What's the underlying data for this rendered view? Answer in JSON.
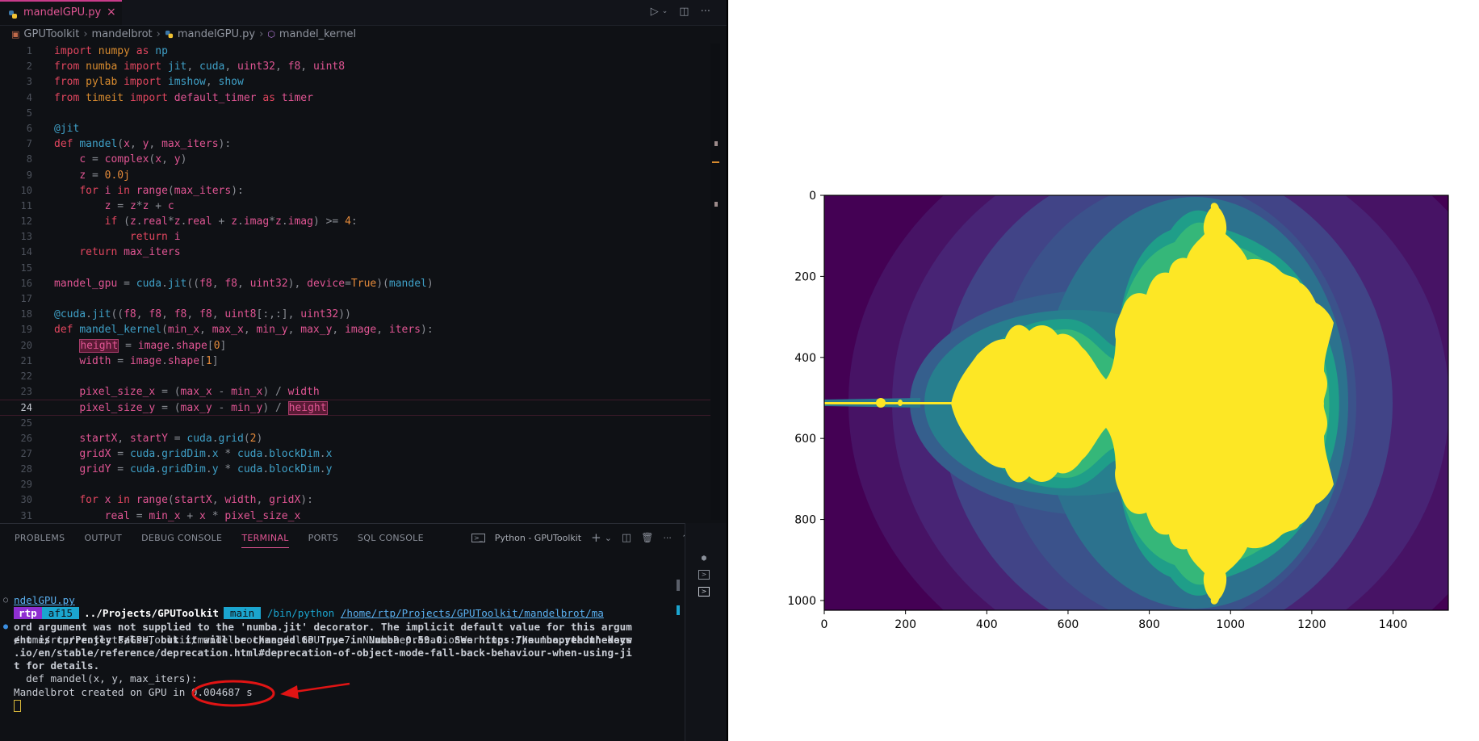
{
  "editor": {
    "tab_label": "mandelGPU.py",
    "tab_close": "×",
    "breadcrumb": [
      "GPUToolkit",
      "mandelbrot",
      "mandelGPU.py",
      "mandel_kernel"
    ],
    "active_line": 24
  },
  "code_lines": [
    "1",
    "2",
    "3",
    "4",
    "5",
    "6",
    "7",
    "8",
    "9",
    "10",
    "11",
    "12",
    "13",
    "14",
    "15",
    "16",
    "17",
    "18",
    "19",
    "20",
    "21",
    "22",
    "23",
    "24",
    "25",
    "26",
    "27",
    "28",
    "29",
    "30",
    "31"
  ],
  "panel": {
    "tabs": [
      "PROBLEMS",
      "OUTPUT",
      "DEBUG CONSOLE",
      "TERMINAL",
      "PORTS",
      "SQL CONSOLE"
    ],
    "active_tab": "TERMINAL",
    "terminal_name": "Python - GPUToolkit"
  },
  "terminal": {
    "prompt_user": "rtp",
    "prompt_hash": "af15",
    "prompt_path": "../Projects/GPUToolkit",
    "prompt_branch": "main",
    "command_prefix": " /bin/python ",
    "command_link_1": "/home/rtp/Projects/GPUToolkit/mandelbrot/ma",
    "command_link_2": "ndelGPU.py",
    "warn_1a": "/home/rtp/Projects/GPUToolkit/mandelbrot/mandelGPU.py:7: NumbaDeprecationWarning: ",
    "warn_1b": "The 'nopython' keyw",
    "warn_2": "ord argument was not supplied to the 'numba.jit' decorator. The implicit default value for this argum",
    "warn_3": "ent is currently False, but it will be changed to True in Numba 0.59.0. See https://numba.readthedocs",
    "warn_4": ".io/en/stable/reference/deprecation.html#deprecation-of-object-mode-fall-back-behaviour-when-using-ji",
    "warn_5": "t for details.",
    "warn_6": "  def mandel(x, y, max_iters):",
    "result_prefix": "Mandelbrot created on GPU in ",
    "result_value": "0.004687 s"
  },
  "chart_data": {
    "type": "heatmap",
    "title": "",
    "xlabel": "",
    "ylabel": "",
    "x_ticks": [
      0,
      200,
      400,
      600,
      800,
      1000,
      1200,
      1400
    ],
    "y_ticks": [
      0,
      200,
      400,
      600,
      800,
      1000
    ],
    "xlim": [
      0,
      1536
    ],
    "ylim": [
      1024,
      0
    ],
    "colormap": "viridis",
    "y_inverted": true,
    "content": "Mandelbrot set iteration counts"
  },
  "colors": {
    "accent": "#e05593",
    "annotation": "#e01414",
    "set_color": "#fde725",
    "background_color": "#440154"
  }
}
